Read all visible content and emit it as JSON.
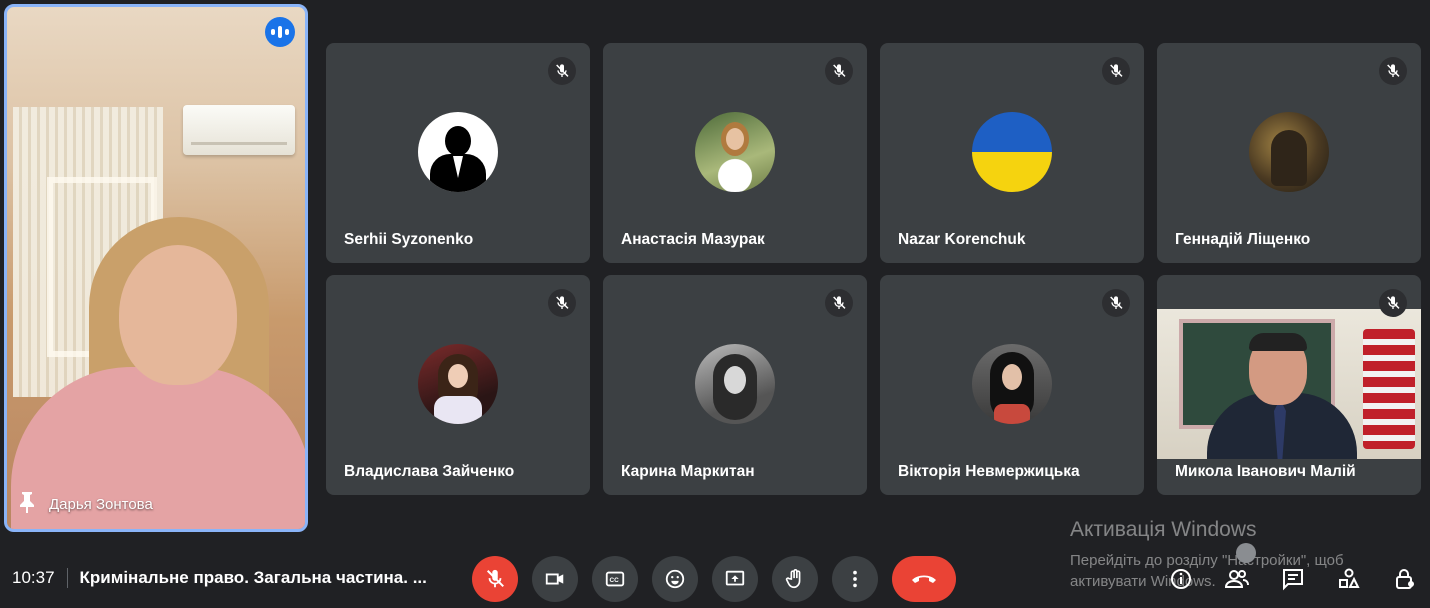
{
  "featured": {
    "name": "Дарья Зонтова",
    "speaking": true,
    "pinned": true
  },
  "tiles": [
    {
      "name": "Serhii Syzonenko",
      "muted": true,
      "avatar": "silhouette-suit"
    },
    {
      "name": "Анастасія Мазурак",
      "muted": true,
      "avatar": "photo"
    },
    {
      "name": "Nazar Korenchuk",
      "muted": true,
      "avatar": "ukraine-flag"
    },
    {
      "name": "Геннадій Ліщенко",
      "muted": true,
      "avatar": "photo"
    },
    {
      "name": "Владислава Зайченко",
      "muted": true,
      "avatar": "photo"
    },
    {
      "name": "Карина Маркитан",
      "muted": true,
      "avatar": "photo"
    },
    {
      "name": "Вікторія Невмержицька",
      "muted": true,
      "avatar": "photo"
    },
    {
      "name": "Микола Іванович Малій",
      "muted": true,
      "avatar": "video"
    }
  ],
  "bottom": {
    "time": "10:37",
    "meeting_title": "Кримінальне право. Загальна частина. ..."
  },
  "controls": [
    "mic-off",
    "camera",
    "captions",
    "emoji",
    "present",
    "raise-hand",
    "more",
    "end-call"
  ],
  "right_controls": [
    "info",
    "people",
    "chat",
    "activities",
    "host-controls"
  ],
  "watermark": {
    "title": "Активація Windows",
    "line1": "Перейдіть до розділу \"Настройки\", щоб",
    "line2": "активувати Windows."
  },
  "colors": {
    "background": "#202124",
    "tile": "#3c4043",
    "accent": "#8ab4f8",
    "red": "#ea4335"
  }
}
